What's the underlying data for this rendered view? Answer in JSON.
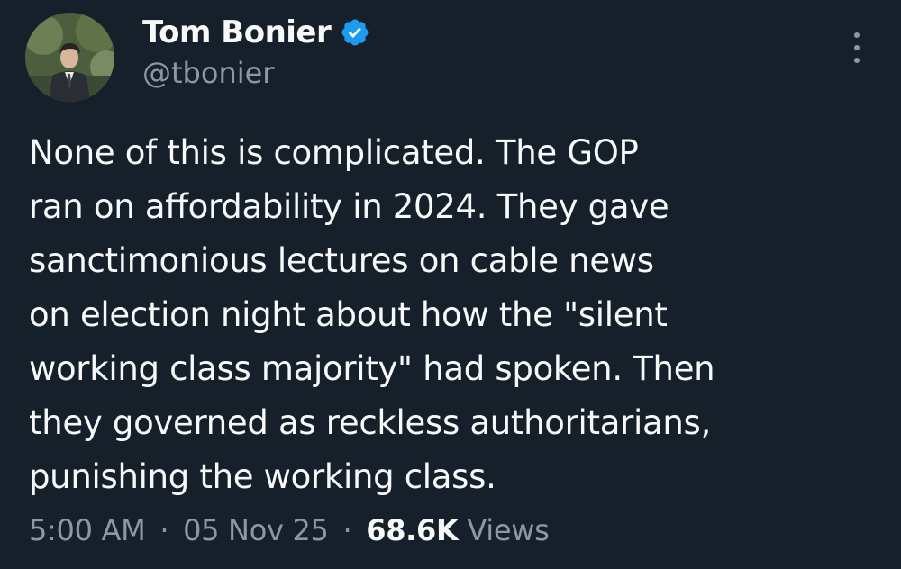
{
  "author": {
    "display_name": "Tom Bonier",
    "handle": "@tbonier",
    "verified": true
  },
  "tweet": {
    "lines": [
      "None of this is complicated. The GOP",
      "ran on affordability in 2024. They gave",
      "sanctimonious lectures on cable news",
      "on election night about how the \"silent",
      "working class majority\" had spoken. Then",
      "they governed as reckless authoritarians,",
      "punishing the working class."
    ]
  },
  "meta": {
    "time": "5:00 AM",
    "separator": "·",
    "date": "05 Nov 25",
    "views_count": "68.6K",
    "views_label": "Views"
  },
  "icons": {
    "verified": "verified-badge-icon",
    "more": "more-options-icon"
  },
  "colors": {
    "background": "#15202b",
    "primary_text": "#f7f9f9",
    "secondary_text": "#8b98a5",
    "verified_blue": "#1d9bf0"
  }
}
